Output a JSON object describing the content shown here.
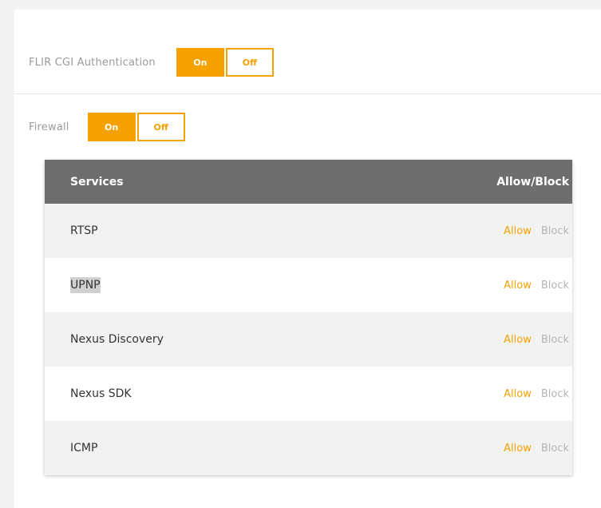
{
  "settings": {
    "cgi_auth": {
      "label": "FLIR CGI Authentication",
      "on": "On",
      "off": "Off"
    },
    "firewall": {
      "label": "Firewall",
      "on": "On",
      "off": "Off"
    }
  },
  "services_table": {
    "header_services": "Services",
    "header_action": "Allow/Block",
    "rows": [
      {
        "name": "RTSP",
        "allow": "Allow",
        "block": "Block"
      },
      {
        "name": "UPNP",
        "allow": "Allow",
        "block": "Block"
      },
      {
        "name": "Nexus Discovery",
        "allow": "Allow",
        "block": "Block"
      },
      {
        "name": "Nexus SDK",
        "allow": "Allow",
        "block": "Block"
      },
      {
        "name": "ICMP",
        "allow": "Allow",
        "block": "Block"
      }
    ]
  },
  "colors": {
    "accent": "#f5a100",
    "header_bg": "#6e6e6e",
    "muted": "#b4b4b4"
  }
}
